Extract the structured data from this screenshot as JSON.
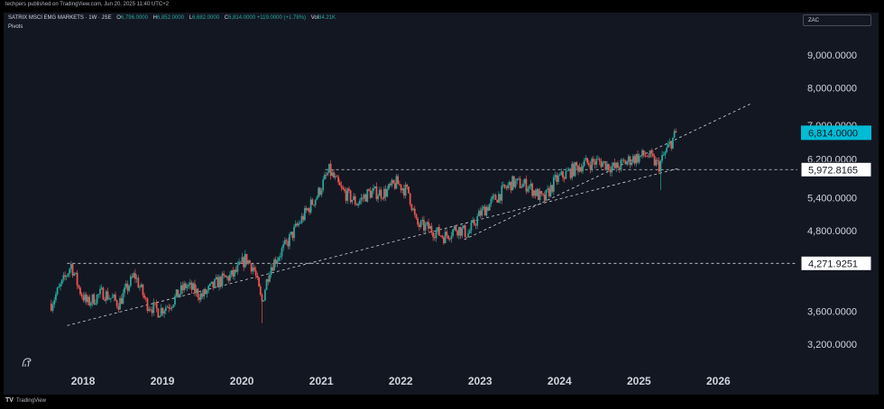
{
  "publisher_line": "techpers published on TradingView.com, Jun 20, 2025 11:40 UTC+2",
  "legend": {
    "symbol": "SATRIX MSCI EMG MARKETS · 1W · JSE",
    "open_label": "O",
    "open": "6,796.0000",
    "high_label": "H",
    "high": "6,852.0000",
    "low_label": "L",
    "low": "6,682.0000",
    "close_label": "C",
    "close": "6,814.0000",
    "change": "+119.0000 (+1.78%)",
    "vol_label": "Vol",
    "vol": "84.21K"
  },
  "indicator": "Pivots",
  "currency": "ZAC",
  "footer": {
    "logo": "TV",
    "brand": "TradingView"
  },
  "colors": {
    "up": "#26a69a",
    "down": "#ef5350",
    "background": "#131722",
    "price_tag": "#00bcd4"
  },
  "chart_data": {
    "type": "candlestick",
    "y_scale": "log",
    "ylim": [
      3000,
      11000
    ],
    "x_ticks": [
      "2018",
      "2019",
      "2020",
      "2021",
      "2022",
      "2023",
      "2024",
      "2025",
      "2026"
    ],
    "y_ticks": [
      {
        "value": 3200,
        "label": "3,200.0000"
      },
      {
        "value": 3600,
        "label": "3,600.0000"
      },
      {
        "value": 4800,
        "label": "4,800.0000"
      },
      {
        "value": 5400,
        "label": "5,400.0000"
      },
      {
        "value": 6200,
        "label": "6,200.0000"
      },
      {
        "value": 7000,
        "label": "7,000.0000"
      },
      {
        "value": 8000,
        "label": "8,000.0000"
      },
      {
        "value": 9000,
        "label": "9,000.0000"
      }
    ],
    "price_tags": [
      {
        "value": 6814,
        "label": "6,814.0000",
        "style": "last"
      },
      {
        "value": 5972.8165,
        "label": "5,972.8165",
        "style": "level"
      },
      {
        "value": 4271.9251,
        "label": "4,271.9251",
        "style": "level"
      }
    ],
    "anchors": [
      {
        "t": 2017.6,
        "p": 3700
      },
      {
        "t": 2017.75,
        "p": 4000
      },
      {
        "t": 2017.85,
        "p": 4250
      },
      {
        "t": 2017.95,
        "p": 3900
      },
      {
        "t": 2018.05,
        "p": 3700
      },
      {
        "t": 2018.25,
        "p": 3850
      },
      {
        "t": 2018.45,
        "p": 3700
      },
      {
        "t": 2018.65,
        "p": 4100
      },
      {
        "t": 2018.8,
        "p": 3700
      },
      {
        "t": 2018.95,
        "p": 3600
      },
      {
        "t": 2019.1,
        "p": 3700
      },
      {
        "t": 2019.3,
        "p": 3950
      },
      {
        "t": 2019.5,
        "p": 3800
      },
      {
        "t": 2019.7,
        "p": 4000
      },
      {
        "t": 2019.9,
        "p": 4100
      },
      {
        "t": 2020.05,
        "p": 4350
      },
      {
        "t": 2020.15,
        "p": 4200
      },
      {
        "t": 2020.25,
        "p": 3700
      },
      {
        "t": 2020.35,
        "p": 4200
      },
      {
        "t": 2020.55,
        "p": 4550
      },
      {
        "t": 2020.75,
        "p": 5000
      },
      {
        "t": 2020.95,
        "p": 5450
      },
      {
        "t": 2021.1,
        "p": 5950
      },
      {
        "t": 2021.25,
        "p": 5550
      },
      {
        "t": 2021.45,
        "p": 5300
      },
      {
        "t": 2021.6,
        "p": 5500
      },
      {
        "t": 2021.8,
        "p": 5500
      },
      {
        "t": 2021.95,
        "p": 5700
      },
      {
        "t": 2022.1,
        "p": 5500
      },
      {
        "t": 2022.2,
        "p": 4900
      },
      {
        "t": 2022.35,
        "p": 4850
      },
      {
        "t": 2022.55,
        "p": 4700
      },
      {
        "t": 2022.7,
        "p": 4850
      },
      {
        "t": 2022.85,
        "p": 4750
      },
      {
        "t": 2023.0,
        "p": 5100
      },
      {
        "t": 2023.2,
        "p": 5400
      },
      {
        "t": 2023.4,
        "p": 5700
      },
      {
        "t": 2023.6,
        "p": 5650
      },
      {
        "t": 2023.8,
        "p": 5350
      },
      {
        "t": 2023.95,
        "p": 5750
      },
      {
        "t": 2024.1,
        "p": 5900
      },
      {
        "t": 2024.3,
        "p": 6100
      },
      {
        "t": 2024.5,
        "p": 6150
      },
      {
        "t": 2024.7,
        "p": 6000
      },
      {
        "t": 2024.9,
        "p": 6200
      },
      {
        "t": 2025.1,
        "p": 6300
      },
      {
        "t": 2025.25,
        "p": 6050
      },
      {
        "t": 2025.35,
        "p": 6400
      },
      {
        "t": 2025.47,
        "p": 6814
      }
    ],
    "spikes": [
      {
        "t": 2020.25,
        "low": 3450
      },
      {
        "t": 2025.27,
        "low": 5550
      }
    ],
    "trendlines": [
      {
        "from": {
          "t": 2017.8,
          "p": 3420
        },
        "to": {
          "t": 2025.5,
          "p": 6000
        },
        "style": "dashed"
      },
      {
        "from": {
          "t": 2022.8,
          "p": 4650
        },
        "to": {
          "t": 2026.4,
          "p": 7550
        },
        "style": "dashed"
      }
    ],
    "horizontal_levels": [
      {
        "from_t": 2017.8,
        "p": 4271.9251,
        "style": "dashed"
      },
      {
        "from_t": 2021.05,
        "p": 5972.8165,
        "style": "dashed"
      }
    ],
    "last_time": 2025.47,
    "last_close": 6814
  }
}
